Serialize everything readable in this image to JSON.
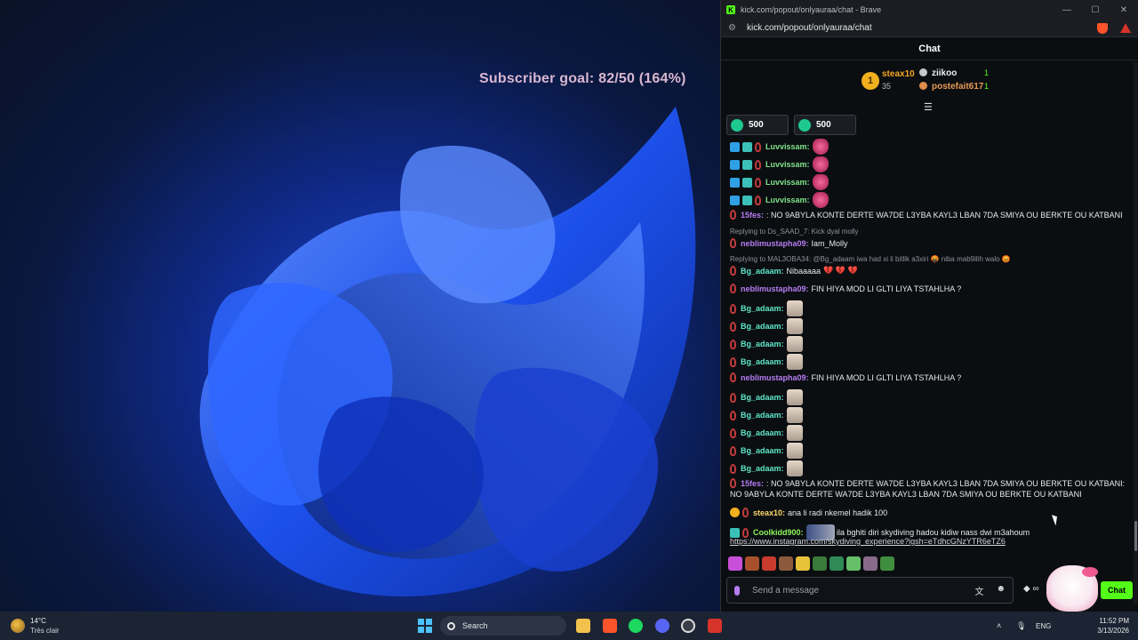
{
  "desktop": {
    "overlay_text": "Subscriber goal: 82/50 (164%)"
  },
  "browser": {
    "window_title": "kick.com/popout/onlyauraa/chat - Brave",
    "url": "kick.com/popout/onlyauraa/chat"
  },
  "chat": {
    "header": "Chat",
    "leaderboard": {
      "first_rank": "1",
      "first_name": "steax10",
      "first_count": "35",
      "second_name": "ziikoo",
      "second_count": "1",
      "third_name": "postefait617",
      "third_count": "1"
    },
    "gifts": [
      {
        "amount": "500"
      },
      {
        "amount": "500"
      }
    ],
    "messages": [
      {
        "user": "Luvvissam:",
        "text": "",
        "emote": "heart"
      },
      {
        "user": "Luvvissam:",
        "text": "",
        "emote": "heart"
      },
      {
        "user": "Luvvissam:",
        "text": "",
        "emote": "heart"
      },
      {
        "user": "Luvvissam:",
        "text": "",
        "emote": "heart"
      },
      {
        "user": "15fes:",
        "text": ": NO 9ABYLA KONTE DERTE WA7DE L3YBA KAYL3 LBAN 7DA SMIYA OU BERKTE OU KATBANI"
      },
      {
        "reply": "Replying to Ds_SAAD_7: Kick dyal molly"
      },
      {
        "user": "neblimustapha09:",
        "text": "Iam_Molly"
      },
      {
        "reply": "Replying to MAL3OBA34: @Bg_adaam iwa had xi li bitlik a3xiri 🤬 niba mab9ilih walo 😡"
      },
      {
        "user": "Bg_adaam:",
        "text": "Nibaaaaa",
        "hearts": "💔 💔 💔"
      },
      {
        "user": "neblimustapha09:",
        "text": "FIN HIYA MOD LI GLTI LIYA TSTAHLHA ?"
      },
      {
        "user": "Bg_adaam:",
        "text": "",
        "emote": "cat"
      },
      {
        "user": "Bg_adaam:",
        "text": "",
        "emote": "cat"
      },
      {
        "user": "Bg_adaam:",
        "text": "",
        "emote": "cat"
      },
      {
        "user": "Bg_adaam:",
        "text": "",
        "emote": "cat"
      },
      {
        "user": "neblimustapha09:",
        "text": "FIN HIYA MOD LI GLTI LIYA TSTAHLHA ?"
      },
      {
        "user": "Bg_adaam:",
        "text": "",
        "emote": "cat"
      },
      {
        "user": "Bg_adaam:",
        "text": "",
        "emote": "cat"
      },
      {
        "user": "Bg_adaam:",
        "text": "",
        "emote": "cat"
      },
      {
        "user": "Bg_adaam:",
        "text": "",
        "emote": "cat"
      },
      {
        "user": "Bg_adaam:",
        "text": "",
        "emote": "cat"
      },
      {
        "user": "15fes:",
        "text": ": NO 9ABYLA KONTE DERTE WA7DE L3YBA KAYL3 LBAN 7DA SMIYA OU BERKTE OU KATBANI:",
        "text2": "NO 9ABYLA KONTE DERTE WA7DE L3YBA KAYL3 LBAN 7DA SMIYA OU BERKTE OU KATBANI"
      },
      {
        "user": "steax10:",
        "text": "ana li radi nkemel hadik 100"
      },
      {
        "user": "Coolkidd900:",
        "text": "ila bghiti diri skydiving hadou kidiw nass dwi m3ahoum",
        "link": "https://www.instagram.com/skydiving_experience?igsh=eTdhcGNzYTR6eTZ6"
      }
    ],
    "input_placeholder": "Send a message",
    "send_label": "Chat"
  },
  "taskbar": {
    "weather_temp": "14°C",
    "weather_desc": "Très clair",
    "search_label": "Search",
    "language": "ENG",
    "time": "11:52 PM",
    "date": "3/13/2026"
  },
  "colors": {
    "kick_green": "#53fc18",
    "chat_bg": "#0b0e11",
    "start_blue": "#4cc2ff"
  }
}
